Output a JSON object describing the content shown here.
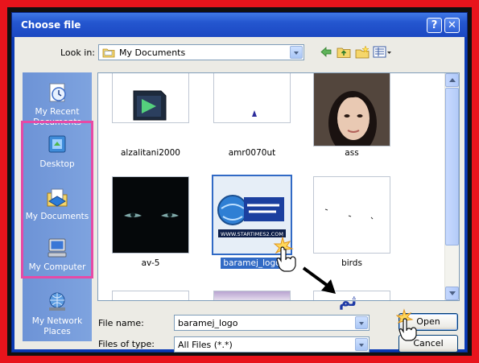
{
  "window": {
    "title": "Choose file"
  },
  "title_buttons": {
    "help": "?",
    "close": "✕"
  },
  "lookin": {
    "label": "Look in:",
    "value": "My Documents"
  },
  "places": [
    {
      "name": "my-recent-documents",
      "label": "My Recent Documents"
    },
    {
      "name": "desktop",
      "label": "Desktop"
    },
    {
      "name": "my-documents",
      "label": "My Documents"
    },
    {
      "name": "my-computer",
      "label": "My Computer"
    },
    {
      "name": "my-network-places",
      "label": "My Network Places"
    }
  ],
  "files": [
    {
      "name": "alzalitani2000"
    },
    {
      "name": "amr0070ut"
    },
    {
      "name": "ass"
    },
    {
      "name": "av-5"
    },
    {
      "name": "baramej_logo",
      "selected": true,
      "thumb_text": "WWW.STARTIMES2.COM"
    },
    {
      "name": "birds"
    }
  ],
  "filename": {
    "label": "File name:",
    "value": "baramej_logo"
  },
  "filetype": {
    "label": "Files of type:",
    "value": "All Files (*.*)"
  },
  "buttons": {
    "open": "Open",
    "cancel": "Cancel"
  },
  "annotation": {
    "arabic": "ثم"
  },
  "colors": {
    "title_bar": "#2456cf",
    "frame": "#e8141c",
    "highlight": "#e64aa6",
    "places_bar": "#7ea3df",
    "selection": "#316ac5"
  }
}
